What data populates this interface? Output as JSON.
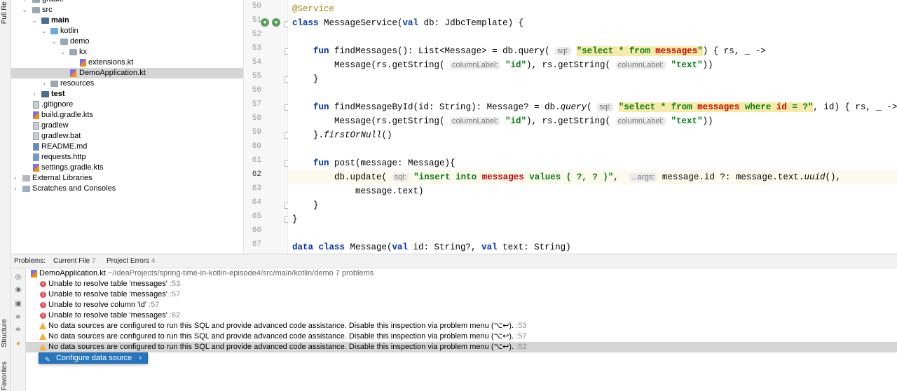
{
  "side_labels": {
    "pull_requests": "Pull Re",
    "structure": "Structure",
    "favorites": "Favorites"
  },
  "project_tree": [
    {
      "label": "gradle",
      "icon": "folder-icon",
      "bold": false
    },
    {
      "label": "src",
      "icon": "folder-icon",
      "bold": false
    },
    {
      "label": "main",
      "icon": "folder-icon",
      "bold": true
    },
    {
      "label": "kotlin",
      "icon": "folder-icon",
      "bold": false
    },
    {
      "label": "demo",
      "icon": "package-icon",
      "bold": false
    },
    {
      "label": "kx",
      "icon": "package-icon",
      "bold": false
    },
    {
      "label": "extensions.kt",
      "icon": "kotlin-file-icon",
      "bold": false
    },
    {
      "label": "DemoApplication.kt",
      "icon": "kotlin-file-icon",
      "bold": false,
      "selected": true
    },
    {
      "label": "resources",
      "icon": "folder-icon",
      "bold": false
    },
    {
      "label": "test",
      "icon": "folder-icon",
      "bold": true
    },
    {
      "label": ".gitignore",
      "icon": "file-icon",
      "bold": false
    },
    {
      "label": "build.gradle.kts",
      "icon": "kotlin-file-icon",
      "bold": false
    },
    {
      "label": "gradlew",
      "icon": "file-icon",
      "bold": false
    },
    {
      "label": "gradlew.bat",
      "icon": "file-icon",
      "bold": false
    },
    {
      "label": "README.md",
      "icon": "markdown-file-icon",
      "bold": false
    },
    {
      "label": "requests.http",
      "icon": "http-file-icon",
      "bold": false
    },
    {
      "label": "settings.gradle.kts",
      "icon": "kotlin-file-icon",
      "bold": false
    },
    {
      "label": "External Libraries",
      "icon": "libraries-icon",
      "bold": false
    },
    {
      "label": "Scratches and Consoles",
      "icon": "scratches-icon",
      "bold": false
    }
  ],
  "editor": {
    "line_numbers": [
      "50",
      "51",
      "52",
      "53",
      "54",
      "55",
      "56",
      "57",
      "58",
      "59",
      "60",
      "61",
      "62",
      "63",
      "64",
      "65",
      "66",
      "67"
    ],
    "current_line": "62"
  },
  "problems": {
    "tabs": [
      {
        "label": "Problems:",
        "count": ""
      },
      {
        "label": "Current File",
        "count": "7"
      },
      {
        "label": "Project Errors",
        "count": "4"
      }
    ],
    "file": {
      "name": "DemoApplication.kt",
      "path": "~/IdeaProjects/spring-time-in-kotlin-episode4/src/main/kotlin/demo",
      "count": "7 problems"
    },
    "items": [
      {
        "severity": "error",
        "text": "Unable to resolve table 'messages'",
        "line": ":53"
      },
      {
        "severity": "error",
        "text": "Unable to resolve table 'messages'",
        "line": ":57"
      },
      {
        "severity": "error",
        "text": "Unable to resolve column 'id'",
        "line": ":57"
      },
      {
        "severity": "error",
        "text": "Unable to resolve table 'messages'",
        "line": ":62"
      },
      {
        "severity": "warning",
        "text": "No data sources are configured to run this SQL and provide advanced code assistance. Disable this inspection via problem menu (⌥↩).",
        "line": ":53"
      },
      {
        "severity": "warning",
        "text": "No data sources are configured to run this SQL and provide advanced code assistance. Disable this inspection via problem menu (⌥↩).",
        "line": ":57"
      },
      {
        "severity": "warning",
        "text": "No data sources are configured to run this SQL and provide advanced code assistance. Disable this inspection via problem menu (⌥↩).",
        "line": ":62",
        "selected": true
      }
    ],
    "popup": {
      "label": "Configure data source",
      "arrow": "›"
    }
  },
  "colors": {
    "keyword": "#0033b3",
    "string": "#067d17",
    "annotation": "#9e880d",
    "selection": "#d5d5d5",
    "popup": "#2675bf"
  }
}
